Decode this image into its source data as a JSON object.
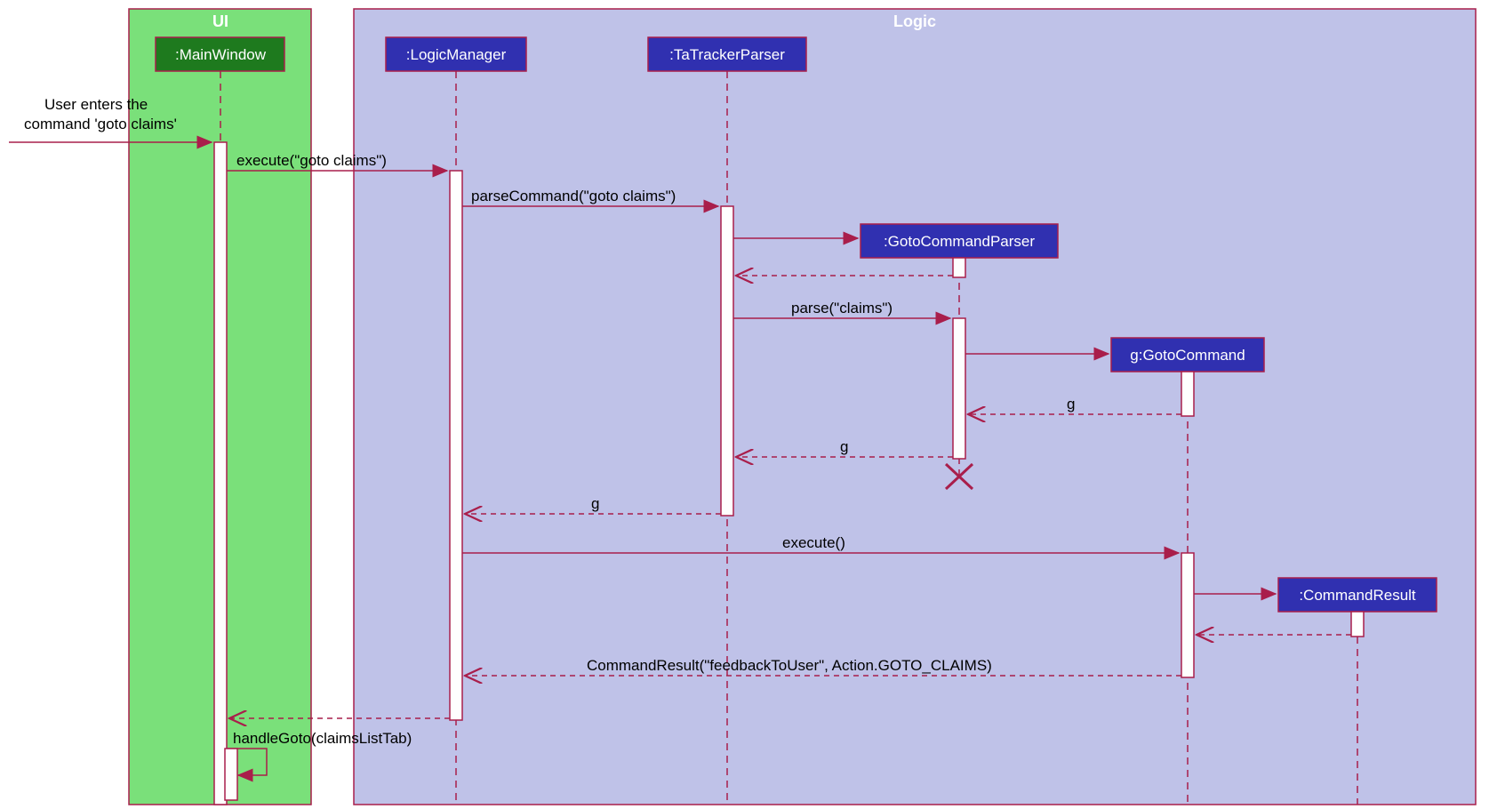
{
  "containers": {
    "ui": {
      "label": "UI"
    },
    "logic": {
      "label": "Logic"
    }
  },
  "lifelines": {
    "mainWindow": ":MainWindow",
    "logicManager": ":LogicManager",
    "taTrackerParser": ":TaTrackerParser",
    "gotoCommandParser": ":GotoCommandParser",
    "gotoCommand": "g:GotoCommand",
    "commandResult": ":CommandResult"
  },
  "messages": {
    "userEnters": "User enters the\ncommand 'goto claims'",
    "execute": "execute(\"goto claims\")",
    "parseCommand": "parseCommand(\"goto claims\")",
    "parseClaims": "parse(\"claims\")",
    "g1": "g",
    "g2": "g",
    "g3": "g",
    "executeEmpty": "execute()",
    "commandResult": "CommandResult(\"feedbackToUser\", Action.GOTO_CLAIMS)",
    "handleGoto": "handleGoto(claimsListTab)"
  }
}
